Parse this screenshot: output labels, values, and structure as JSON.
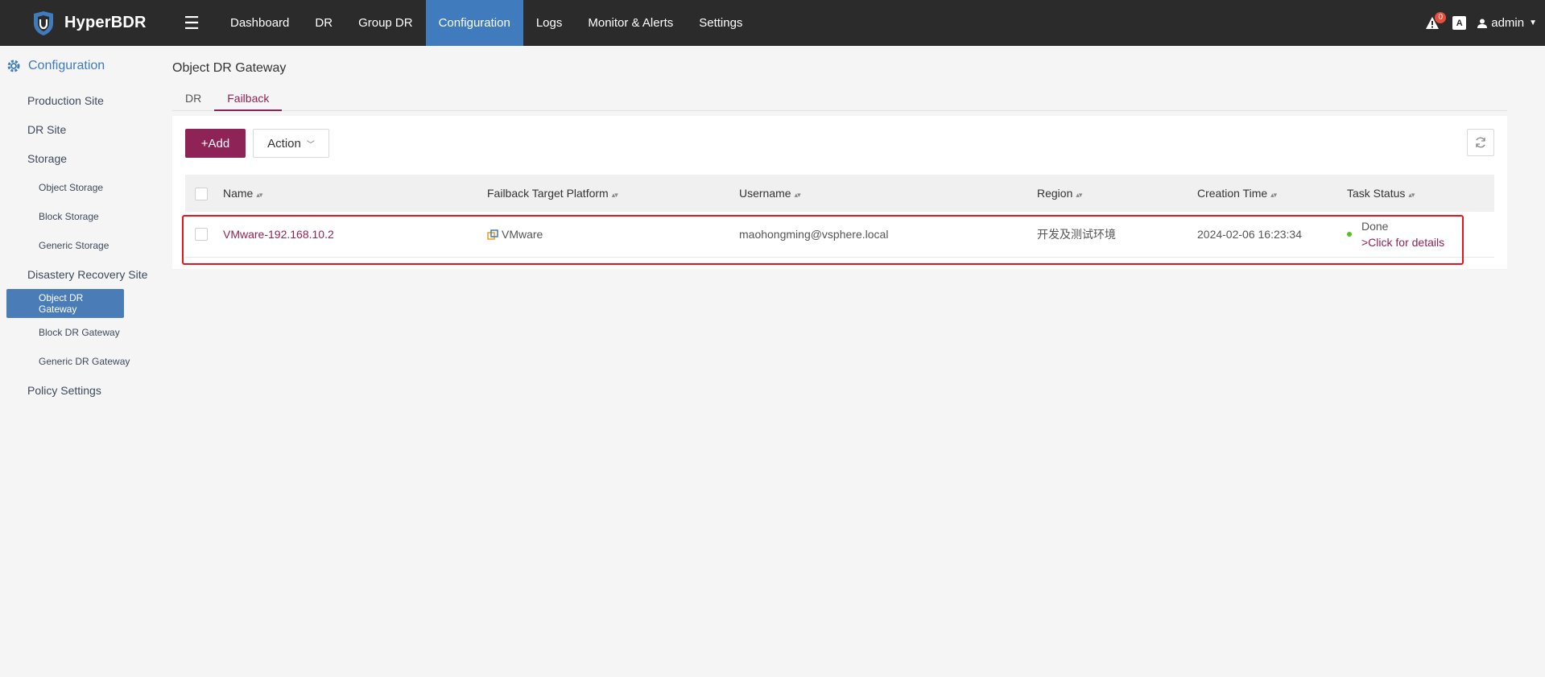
{
  "app": {
    "name": "HyperBDR"
  },
  "nav": {
    "items": [
      "Dashboard",
      "DR",
      "Group DR",
      "Configuration",
      "Logs",
      "Monitor & Alerts",
      "Settings"
    ],
    "active": "Configuration"
  },
  "header_right": {
    "alert_count": "0",
    "lang_label": "A",
    "user": "admin"
  },
  "sidebar": {
    "section": "Configuration",
    "items": [
      {
        "label": "Production Site"
      },
      {
        "label": "DR Site"
      },
      {
        "label": "Storage"
      },
      {
        "label": "Object Storage"
      },
      {
        "label": "Block Storage"
      },
      {
        "label": "Generic Storage"
      },
      {
        "label": "Disastery Recovery Site"
      },
      {
        "label": "Object DR Gateway"
      },
      {
        "label": "Block DR Gateway"
      },
      {
        "label": "Generic DR Gateway"
      },
      {
        "label": "Policy Settings"
      }
    ]
  },
  "page": {
    "title": "Object DR Gateway",
    "tabs": [
      "DR",
      "Failback"
    ],
    "active_tab": "Failback"
  },
  "toolbar": {
    "add_label": "+Add",
    "action_label": "Action"
  },
  "table": {
    "headers": [
      "Name",
      "Failback Target Platform",
      "Username",
      "Region",
      "Creation Time",
      "Task Status"
    ],
    "rows": [
      {
        "name": "VMware-192.168.10.2",
        "platform": "VMware",
        "username": "maohongming@vsphere.local",
        "region": "开发及测试环境",
        "created": "2024-02-06 16:23:34",
        "status": "Done",
        "status_link": ">Click for details"
      }
    ]
  },
  "colors": {
    "accent": "#8e2358",
    "nav_active": "#3f7bbd",
    "topbar": "#2b2b2b",
    "status_ok": "#52c41a",
    "highlight": "#e8141c"
  }
}
